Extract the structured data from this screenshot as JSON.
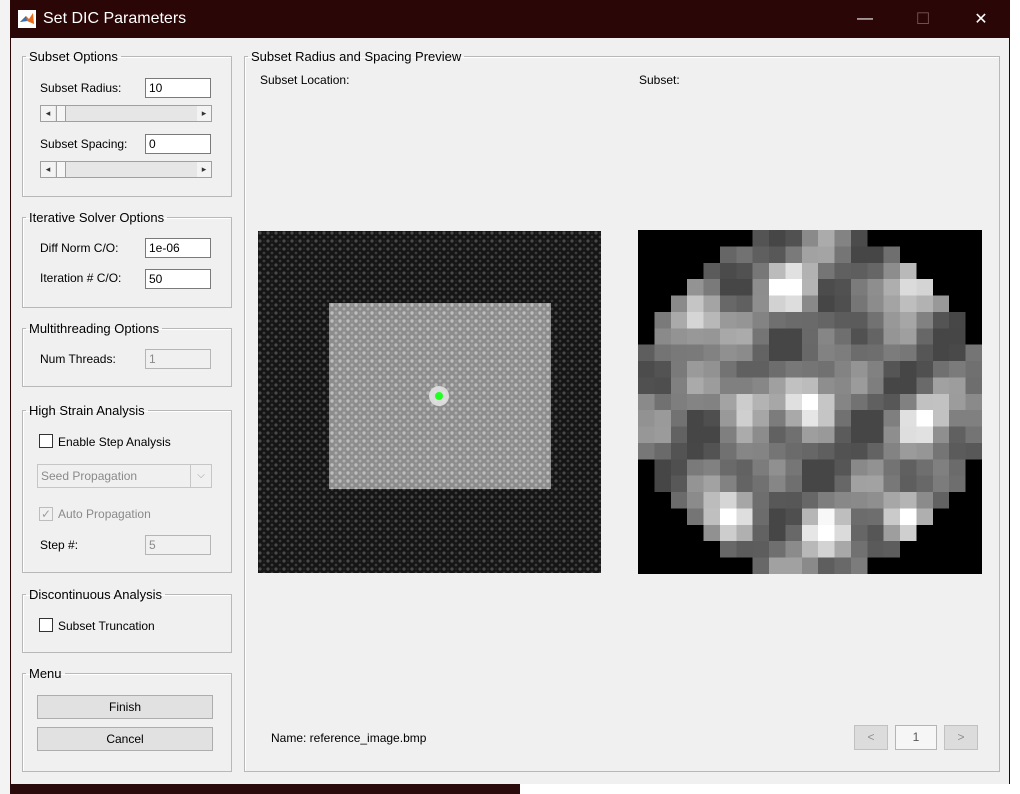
{
  "window": {
    "title": "Set DIC Parameters",
    "controls": {
      "minimize": "—",
      "maximize": "☐",
      "close": "✕"
    }
  },
  "subset_options": {
    "title": "Subset Options",
    "radius_label": "Subset Radius:",
    "radius_value": "10",
    "spacing_label": "Subset Spacing:",
    "spacing_value": "0"
  },
  "iterative_solver": {
    "title": "Iterative Solver Options",
    "diff_norm_label": "Diff Norm C/O:",
    "diff_norm_value": "1e-06",
    "iteration_label": "Iteration # C/O:",
    "iteration_value": "50"
  },
  "multithreading": {
    "title": "Multithreading Options",
    "threads_label": "Num Threads:",
    "threads_value": "1"
  },
  "high_strain": {
    "title": "High Strain Analysis",
    "enable_step_label": "Enable Step Analysis",
    "enable_step_checked": false,
    "dropdown_value": "Seed Propagation",
    "auto_propagation_label": "Auto Propagation",
    "auto_propagation_checked": true,
    "step_label": "Step #:",
    "step_value": "5"
  },
  "discontinuous": {
    "title": "Discontinuous Analysis",
    "truncation_label": "Subset Truncation",
    "truncation_checked": false
  },
  "menu": {
    "title": "Menu",
    "finish_label": "Finish",
    "cancel_label": "Cancel"
  },
  "preview": {
    "title": "Subset Radius and Spacing Preview",
    "location_label": "Subset Location:",
    "subset_label": "Subset:",
    "name_text": "Name: reference_image.bmp",
    "prev_label": "<",
    "page_value": "1",
    "next_label": ">"
  },
  "colors": {
    "titlebar": "#2a0606",
    "marker": "#22ff22",
    "panel_bg": "#f0f0f0"
  }
}
